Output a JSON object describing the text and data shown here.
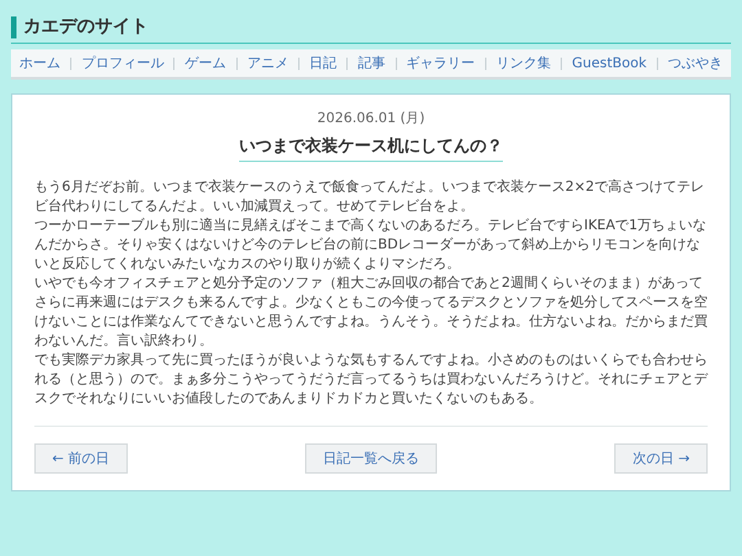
{
  "site_title": "カエデのサイト",
  "nav": [
    "ホーム",
    "プロフィール",
    "ゲーム",
    "アニメ",
    "日記",
    "記事",
    "ギャラリー",
    "リンク集",
    "GuestBook",
    "つぶやき"
  ],
  "entry": {
    "date": "2026.06.01 (月)",
    "title": "いつまで衣装ケース机にしてんの？",
    "paragraphs": [
      "もう6月だぞお前。いつまで衣装ケースのうえで飯食ってんだよ。いつまで衣装ケース2×2で高さつけてテレビ台代わりにしてるんだよ。いい加減買えって。せめてテレビ台をよ。",
      "つーかローテーブルも別に適当に見繕えばそこまで高くないのあるだろ。テレビ台ですらIKEAで1万ちょいなんだからさ。そりゃ安くはないけど今のテレビ台の前にBDレコーダーがあって斜め上からリモコンを向けないと反応してくれないみたいなカスのやり取りが続くよりマシだろ。",
      "いやでも今オフィスチェアと処分予定のソファ（粗大ごみ回収の都合であと2週間くらいそのまま）があってさらに再来週にはデスクも来るんですよ。少なくともこの今使ってるデスクとソファを処分してスペースを空けないことには作業なんてできないと思うんですよね。うんそう。そうだよね。仕方ないよね。だからまだ買わないんだ。言い訳終わり。",
      "でも実際デカ家具って先に買ったほうが良いような気もするんですよね。小さめのものはいくらでも合わせられる（と思う）ので。まぁ多分こうやってうだうだ言ってるうちは買わないんだろうけど。それにチェアとデスクでそれなりにいいお値段したのであんまりドカドカと買いたくないのもある。"
    ]
  },
  "pager": {
    "prev": "← 前の日",
    "index": "日記一覧へ戻る",
    "next": "次の日 →"
  }
}
